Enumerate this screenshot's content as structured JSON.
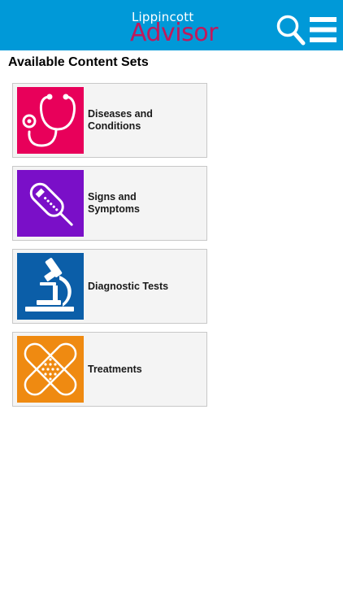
{
  "header": {
    "logo_top": "Lippincott",
    "logo_main": "Advisor",
    "search_icon": "search-icon",
    "menu_icon": "hamburger-menu-icon",
    "background_color": "#0099d8",
    "logo_main_color": "#c1185b"
  },
  "main": {
    "title": "Available Content Sets",
    "cards": [
      {
        "label_line1": "Diseases and",
        "label_line2": "Conditions",
        "icon": "stethoscope-icon",
        "color": "#e8005a"
      },
      {
        "label_line1": "Signs and",
        "label_line2": "Symptoms",
        "icon": "thermometer-icon",
        "color": "#7a0fc8"
      },
      {
        "label_line1": "Diagnostic Tests",
        "label_line2": "",
        "icon": "microscope-icon",
        "color": "#0b5ea8"
      },
      {
        "label_line1": "Treatments",
        "label_line2": "",
        "icon": "bandage-icon",
        "color": "#ef8a11"
      }
    ]
  }
}
